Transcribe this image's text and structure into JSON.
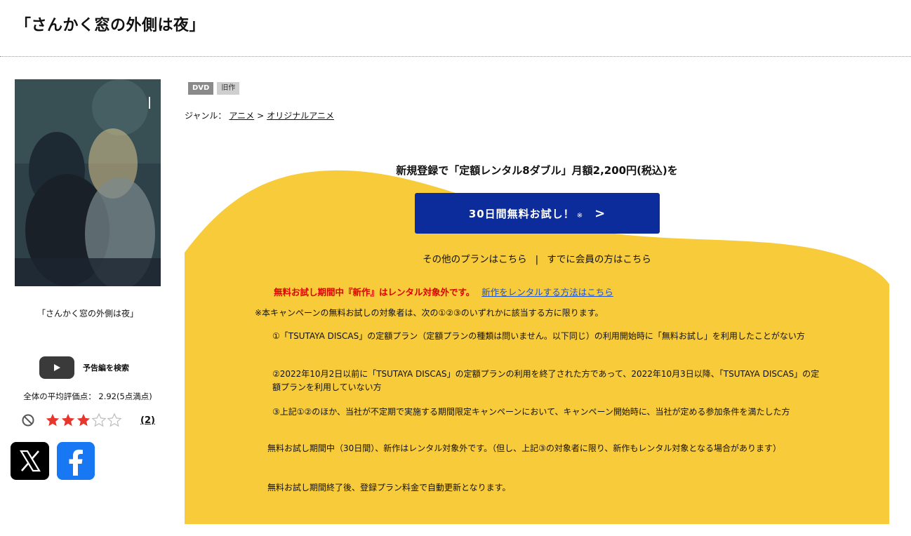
{
  "page": {
    "title": "「さんかく窓の外側は夜」"
  },
  "cover": {
    "caption": "「さんかく窓の外側は夜」"
  },
  "trailer": {
    "label": "予告編を検索"
  },
  "rating": {
    "average_text": "全体の平均評価点： 2.92(5点満点)",
    "value": 2.92,
    "max": 5,
    "stars_filled": 3,
    "review_count": "(2)"
  },
  "tags": {
    "format": "DVD",
    "age": "旧作"
  },
  "genre": {
    "label": "ジャンル：",
    "primary": "アニメ",
    "separator": ">",
    "secondary": "オリジナルアニメ"
  },
  "promo": {
    "headline": "新規登録で「定額レンタル8ダブル」月額2,200円(税込)を",
    "cta_label": "30日間無料お試し！",
    "cta_note_mark": "※",
    "cta_chevron": ">",
    "other_plans": "その他のプランはこちら",
    "link_separator": "|",
    "member_link": "すでに会員の方はこちら",
    "notice_red": "無料お試し期間中『新作』はレンタル対象外です。",
    "notice_link": "新作をレンタルする方法はこちら",
    "terms_intro": "※本キャンペーンの無料お試しの対象者は、次の①②③のいずれかに該当する方に限ります。",
    "term_1": "①「TSUTAYA DISCAS」の定額プラン（定額プランの種類は問いません。以下同じ）の利用開始時に「無料お試し」を利用したことがない方",
    "term_2": "②2022年10月2日以前に「TSUTAYA DISCAS」の定額プランの利用を終了された方であって、2022年10月3日以降、「TSUTAYA DISCAS」の定額プランを利用していない方",
    "term_3": "③上記①②のほか、当社が不定期で実施する期間限定キャンペーンにおいて、キャンペーン開始時に、当社が定める参加条件を満たした方",
    "term_4": "無料お試し期間中（30日間）、新作はレンタル対象外です。（但し、上記③の対象者に限り、新作もレンタル対象となる場合があります）",
    "term_5": "無料お試し期間終了後、登録プラン料金で自動更新となります。"
  },
  "colors": {
    "promo_yellow": "#f8cb3a",
    "cta_blue": "#0b2c9a",
    "notice_red": "#e00000",
    "link_blue": "#1a53d6",
    "star_filled": "#e8352d",
    "star_empty": "#bdbdbd"
  },
  "icons": {
    "youtube": "play-icon",
    "rating_reset": "no-entry-icon",
    "x": "x-logo-icon",
    "facebook": "facebook-logo-icon"
  }
}
